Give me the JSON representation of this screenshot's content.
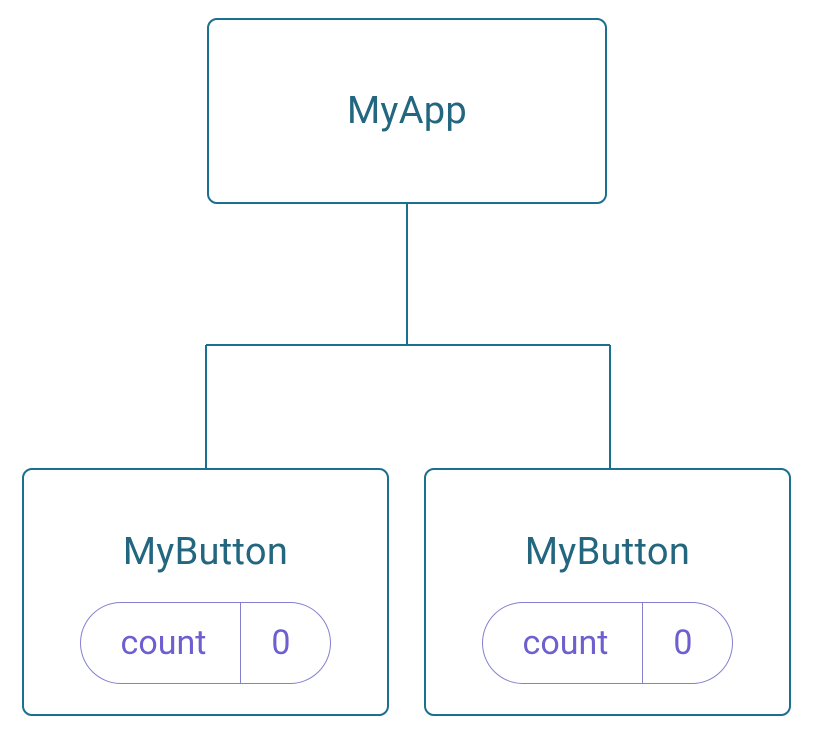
{
  "tree": {
    "root": {
      "label": "MyApp"
    },
    "children": [
      {
        "label": "MyButton",
        "state": {
          "name": "count",
          "value": "0"
        }
      },
      {
        "label": "MyButton",
        "state": {
          "name": "count",
          "value": "0"
        }
      }
    ]
  },
  "colors": {
    "nodeBorder": "#1b6f8f",
    "nodeText": "#23667f",
    "pillBorder": "#8480d0",
    "pillText": "#6d5fcf"
  }
}
